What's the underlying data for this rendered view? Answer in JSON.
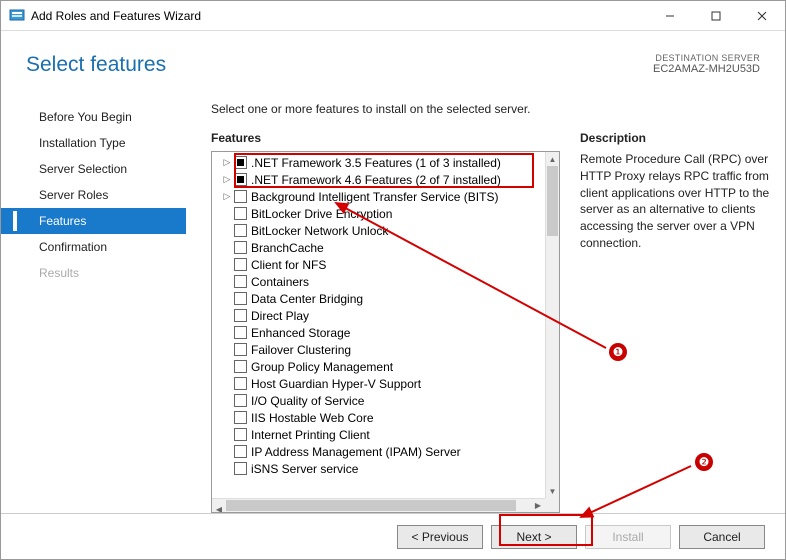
{
  "window": {
    "title": "Add Roles and Features Wizard",
    "page_title": "Select features",
    "destination_label": "DESTINATION SERVER",
    "destination_value": "EC2AMAZ-MH2U53D",
    "instruction": "Select one or more features to install on the selected server."
  },
  "nav": {
    "items": [
      {
        "label": "Before You Begin",
        "state": "normal"
      },
      {
        "label": "Installation Type",
        "state": "normal"
      },
      {
        "label": "Server Selection",
        "state": "normal"
      },
      {
        "label": "Server Roles",
        "state": "normal"
      },
      {
        "label": "Features",
        "state": "active"
      },
      {
        "label": "Confirmation",
        "state": "normal"
      },
      {
        "label": "Results",
        "state": "disabled"
      }
    ]
  },
  "features": {
    "section_label": "Features",
    "items": [
      {
        "label": ".NET Framework 3.5 Features (1 of 3 installed)",
        "check": "partial",
        "expandable": true
      },
      {
        "label": ".NET Framework 4.6 Features (2 of 7 installed)",
        "check": "partial",
        "expandable": true
      },
      {
        "label": "Background Intelligent Transfer Service (BITS)",
        "check": "unchecked",
        "expandable": true
      },
      {
        "label": "BitLocker Drive Encryption",
        "check": "unchecked",
        "expandable": false
      },
      {
        "label": "BitLocker Network Unlock",
        "check": "unchecked",
        "expandable": false
      },
      {
        "label": "BranchCache",
        "check": "unchecked",
        "expandable": false
      },
      {
        "label": "Client for NFS",
        "check": "unchecked",
        "expandable": false
      },
      {
        "label": "Containers",
        "check": "unchecked",
        "expandable": false
      },
      {
        "label": "Data Center Bridging",
        "check": "unchecked",
        "expandable": false
      },
      {
        "label": "Direct Play",
        "check": "unchecked",
        "expandable": false
      },
      {
        "label": "Enhanced Storage",
        "check": "unchecked",
        "expandable": false
      },
      {
        "label": "Failover Clustering",
        "check": "unchecked",
        "expandable": false
      },
      {
        "label": "Group Policy Management",
        "check": "unchecked",
        "expandable": false
      },
      {
        "label": "Host Guardian Hyper-V Support",
        "check": "unchecked",
        "expandable": false
      },
      {
        "label": "I/O Quality of Service",
        "check": "unchecked",
        "expandable": false
      },
      {
        "label": "IIS Hostable Web Core",
        "check": "unchecked",
        "expandable": false
      },
      {
        "label": "Internet Printing Client",
        "check": "unchecked",
        "expandable": false
      },
      {
        "label": "IP Address Management (IPAM) Server",
        "check": "unchecked",
        "expandable": false
      },
      {
        "label": "iSNS Server service",
        "check": "unchecked",
        "expandable": false
      }
    ]
  },
  "description": {
    "section_label": "Description",
    "text": "Remote Procedure Call (RPC) over HTTP Proxy relays RPC traffic from client applications over HTTP to the server as an alternative to clients accessing the server over a VPN connection."
  },
  "buttons": {
    "previous": "< Previous",
    "next": "Next >",
    "install": "Install",
    "cancel": "Cancel"
  },
  "annotations": {
    "badge1": "❶",
    "badge2": "❷"
  }
}
